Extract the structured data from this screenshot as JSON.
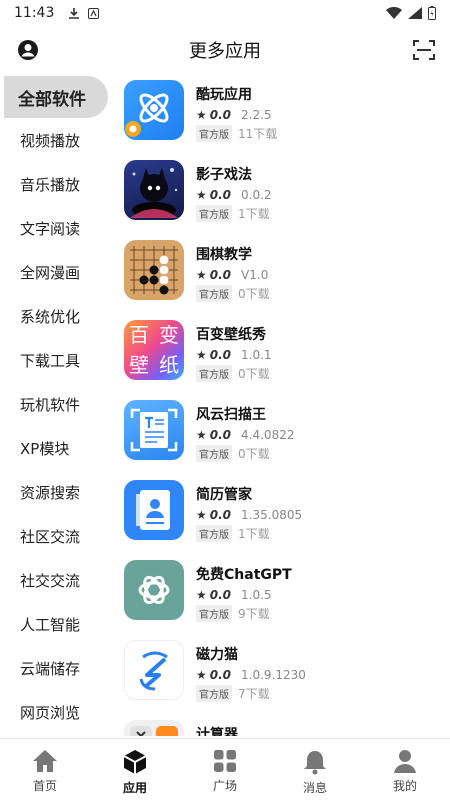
{
  "status": {
    "time": "11:43"
  },
  "header": {
    "title": "更多应用"
  },
  "sidebar": {
    "items": [
      {
        "label": "全部软件",
        "active": true
      },
      {
        "label": "视频播放"
      },
      {
        "label": "音乐播放"
      },
      {
        "label": "文字阅读"
      },
      {
        "label": "全网漫画"
      },
      {
        "label": "系统优化"
      },
      {
        "label": "下载工具"
      },
      {
        "label": "玩机软件"
      },
      {
        "label": "XP模块"
      },
      {
        "label": "资源搜索"
      },
      {
        "label": "社区交流"
      },
      {
        "label": "社交交流"
      },
      {
        "label": "人工智能"
      },
      {
        "label": "云端储存"
      },
      {
        "label": "网页浏览"
      }
    ]
  },
  "apps": [
    {
      "name": "酷玩应用",
      "rating": "0.0",
      "version": "2.2.5",
      "badge": "官方版",
      "downloads": "11下载"
    },
    {
      "name": "影子戏法",
      "rating": "0.0",
      "version": "0.0.2",
      "badge": "官方版",
      "downloads": "1下载"
    },
    {
      "name": "围棋教学",
      "rating": "0.0",
      "version": "V1.0",
      "badge": "官方版",
      "downloads": "0下载"
    },
    {
      "name": "百变壁纸秀",
      "rating": "0.0",
      "version": "1.0.1",
      "badge": "官方版",
      "downloads": "0下载"
    },
    {
      "name": "风云扫描王",
      "rating": "0.0",
      "version": "4.4.0822",
      "badge": "官方版",
      "downloads": "0下载"
    },
    {
      "name": "简历管家",
      "rating": "0.0",
      "version": "1.35.0805",
      "badge": "官方版",
      "downloads": "1下载"
    },
    {
      "name": "免费ChatGPT",
      "rating": "0.0",
      "version": "1.0.5",
      "badge": "官方版",
      "downloads": "9下载"
    },
    {
      "name": "磁力猫",
      "rating": "0.0",
      "version": "1.0.9.1230",
      "badge": "官方版",
      "downloads": "7下载"
    },
    {
      "name": "计算器"
    }
  ],
  "icon_text": {
    "wallpaper": [
      "百",
      "变",
      "壁",
      "纸"
    ]
  },
  "bottom_nav": [
    {
      "label": "首页"
    },
    {
      "label": "应用",
      "active": true
    },
    {
      "label": "广场"
    },
    {
      "label": "消息"
    },
    {
      "label": "我的"
    }
  ],
  "colors": {
    "accent": "#2b8af7",
    "active_bg": "#d9d9d9",
    "nav_icon": "#777777"
  }
}
